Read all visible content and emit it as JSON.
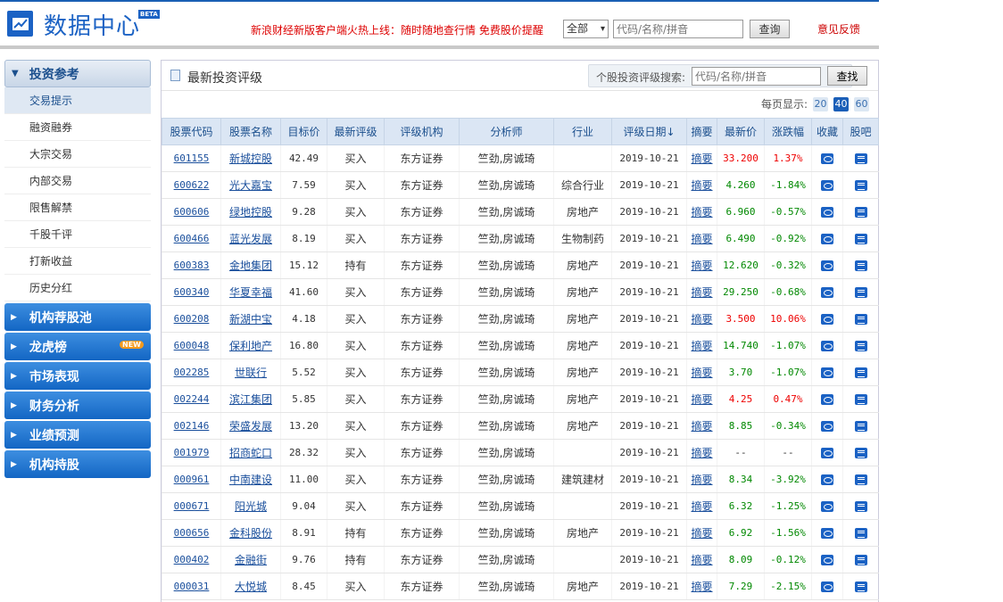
{
  "header": {
    "title": "数据中心",
    "beta": "BETA",
    "promo": "新浪财经新版客户端火热上线：随时随地查行情  免费股价提醒",
    "scope_select": "全部",
    "search_placeholder": "代码/名称/拼音",
    "search_button": "查询",
    "feedback": "意见反馈"
  },
  "sidebar": {
    "section": "投资参考",
    "items": [
      "交易提示",
      "融资融券",
      "大宗交易",
      "内部交易",
      "限售解禁",
      "千股千评",
      "打新收益",
      "历史分红"
    ],
    "groups": [
      "机构荐股池",
      "龙虎榜",
      "市场表现",
      "财务分析",
      "业绩预测",
      "机构持股"
    ],
    "new_badge": "NEW"
  },
  "main": {
    "title": "最新投资评级",
    "search_label": "个股投资评级搜索:",
    "search_placeholder": "代码/名称/拼音",
    "search_button": "查找",
    "perpage_label": "每页显示:",
    "perpage_options": [
      "20",
      "40",
      "60"
    ],
    "columns": [
      "股票代码",
      "股票名称",
      "目标价",
      "最新评级",
      "评级机构",
      "分析师",
      "行业",
      "评级日期↓",
      "摘要",
      "最新价",
      "涨跌幅",
      "收藏",
      "股吧"
    ],
    "rows": [
      [
        "601155",
        "新城控股",
        "42.49",
        "买入",
        "东方证券",
        "竺劲,房诚琦",
        "",
        "2019-10-21",
        "摘要",
        "33.200",
        "1.37%"
      ],
      [
        "600622",
        "光大嘉宝",
        "7.59",
        "买入",
        "东方证券",
        "竺劲,房诚琦",
        "综合行业",
        "2019-10-21",
        "摘要",
        "4.260",
        "-1.84%"
      ],
      [
        "600606",
        "绿地控股",
        "9.28",
        "买入",
        "东方证券",
        "竺劲,房诚琦",
        "房地产",
        "2019-10-21",
        "摘要",
        "6.960",
        "-0.57%"
      ],
      [
        "600466",
        "蓝光发展",
        "8.19",
        "买入",
        "东方证券",
        "竺劲,房诚琦",
        "生物制药",
        "2019-10-21",
        "摘要",
        "6.490",
        "-0.92%"
      ],
      [
        "600383",
        "金地集团",
        "15.12",
        "持有",
        "东方证券",
        "竺劲,房诚琦",
        "房地产",
        "2019-10-21",
        "摘要",
        "12.620",
        "-0.32%"
      ],
      [
        "600340",
        "华夏幸福",
        "41.60",
        "买入",
        "东方证券",
        "竺劲,房诚琦",
        "房地产",
        "2019-10-21",
        "摘要",
        "29.250",
        "-0.68%"
      ],
      [
        "600208",
        "新湖中宝",
        "4.18",
        "买入",
        "东方证券",
        "竺劲,房诚琦",
        "房地产",
        "2019-10-21",
        "摘要",
        "3.500",
        "10.06%"
      ],
      [
        "600048",
        "保利地产",
        "16.80",
        "买入",
        "东方证券",
        "竺劲,房诚琦",
        "房地产",
        "2019-10-21",
        "摘要",
        "14.740",
        "-1.07%"
      ],
      [
        "002285",
        "世联行",
        "5.52",
        "买入",
        "东方证券",
        "竺劲,房诚琦",
        "房地产",
        "2019-10-21",
        "摘要",
        "3.70",
        "-1.07%"
      ],
      [
        "002244",
        "滨江集团",
        "5.85",
        "买入",
        "东方证券",
        "竺劲,房诚琦",
        "房地产",
        "2019-10-21",
        "摘要",
        "4.25",
        "0.47%"
      ],
      [
        "002146",
        "荣盛发展",
        "13.20",
        "买入",
        "东方证券",
        "竺劲,房诚琦",
        "房地产",
        "2019-10-21",
        "摘要",
        "8.85",
        "-0.34%"
      ],
      [
        "001979",
        "招商蛇口",
        "28.32",
        "买入",
        "东方证券",
        "竺劲,房诚琦",
        "",
        "2019-10-21",
        "摘要",
        "--",
        "--"
      ],
      [
        "000961",
        "中南建设",
        "11.00",
        "买入",
        "东方证券",
        "竺劲,房诚琦",
        "建筑建材",
        "2019-10-21",
        "摘要",
        "8.34",
        "-3.92%"
      ],
      [
        "000671",
        "阳光城",
        "9.04",
        "买入",
        "东方证券",
        "竺劲,房诚琦",
        "",
        "2019-10-21",
        "摘要",
        "6.32",
        "-1.25%"
      ],
      [
        "000656",
        "金科股份",
        "8.91",
        "持有",
        "东方证券",
        "竺劲,房诚琦",
        "房地产",
        "2019-10-21",
        "摘要",
        "6.92",
        "-1.56%"
      ],
      [
        "000402",
        "金融街",
        "9.76",
        "持有",
        "东方证券",
        "竺劲,房诚琦",
        "",
        "2019-10-21",
        "摘要",
        "8.09",
        "-0.12%"
      ],
      [
        "000031",
        "大悦城",
        "8.45",
        "买入",
        "东方证券",
        "竺劲,房诚琦",
        "房地产",
        "2019-10-21",
        "摘要",
        "7.29",
        "-2.15%"
      ]
    ]
  }
}
